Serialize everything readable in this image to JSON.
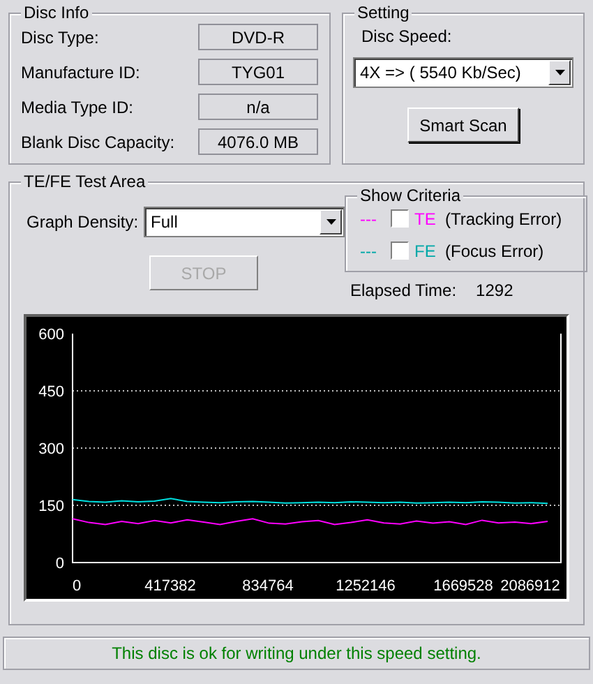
{
  "disc_info": {
    "title": "Disc Info",
    "fields": [
      {
        "label": "Disc Type:",
        "value": "DVD-R"
      },
      {
        "label": "Manufacture ID:",
        "value": "TYG01"
      },
      {
        "label": "Media Type ID:",
        "value": "n/a"
      },
      {
        "label": "Blank Disc Capacity:",
        "value": "4076.0 MB"
      }
    ]
  },
  "setting": {
    "title": "Setting",
    "speed_label": "Disc Speed:",
    "speed_value": "4X => ( 5540 Kb/Sec)",
    "scan_button": "Smart Scan"
  },
  "test_area": {
    "title": "TE/FE Test Area",
    "density_label": "Graph Density:",
    "density_value": "Full",
    "stop_button": {
      "label": "STOP",
      "disabled": true
    },
    "criteria": {
      "title": "Show Criteria",
      "items": [
        {
          "legend": "---",
          "description": "(Tracking Error)",
          "checked": false,
          "color": "#ff00ff"
        },
        {
          "legend": "---",
          "description": "(Focus Error)",
          "checked": false,
          "color": "#00a8a8"
        }
      ]
    },
    "elapsed_label": "Elapsed Time:",
    "elapsed_value": "1292",
    "chart_data": {
      "type": "line",
      "x": [
        0,
        70000,
        140000,
        210000,
        280000,
        350000,
        420000,
        490000,
        560000,
        630000,
        700000,
        770000,
        840000,
        910000,
        980000,
        1050000,
        1120000,
        1190000,
        1260000,
        1330000,
        1400000,
        1470000,
        1540000,
        1610000,
        1680000,
        1750000,
        1820000,
        1890000,
        1960000,
        2030000
      ],
      "series": [
        {
          "name": "TE",
          "color": "#ff00ff",
          "values": [
            115,
            105,
            100,
            108,
            102,
            110,
            104,
            112,
            106,
            100,
            108,
            115,
            103,
            101,
            107,
            110,
            100,
            105,
            112,
            104,
            101,
            109,
            103,
            107,
            100,
            111,
            104,
            106,
            102,
            108
          ]
        },
        {
          "name": "FE",
          "color": "#00e0e0",
          "values": [
            165,
            160,
            158,
            162,
            159,
            161,
            168,
            160,
            158,
            157,
            159,
            160,
            158,
            156,
            157,
            158,
            157,
            159,
            158,
            157,
            158,
            156,
            157,
            158,
            157,
            159,
            158,
            156,
            157,
            155
          ]
        }
      ],
      "grid": true,
      "xlim": [
        0,
        2086912
      ],
      "ylim": [
        0,
        600
      ],
      "xticks": [
        0,
        417382,
        834764,
        1252146,
        1669528,
        2086912
      ],
      "yticks": [
        0,
        150,
        300,
        450,
        600
      ]
    }
  },
  "status": "This disc is ok for writing under this speed setting."
}
